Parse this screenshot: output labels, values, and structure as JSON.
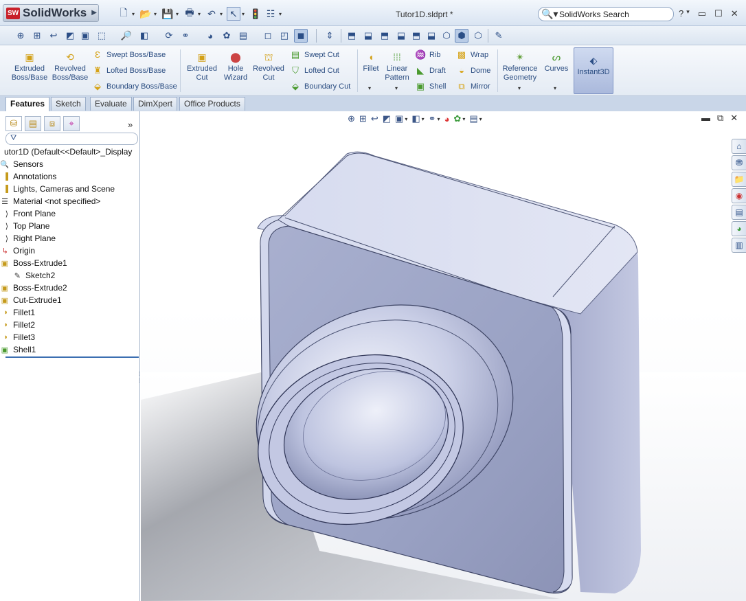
{
  "app": {
    "brand": "SolidWorks",
    "brand_badge": "SW",
    "document_title": "Tutor1D.sldprt *"
  },
  "quick_access": {
    "icons": [
      "new-document-icon",
      "open-folder-icon",
      "save-icon",
      "print-icon",
      "undo-icon",
      "select-pointer-icon",
      "rebuild-icon",
      "options-icon"
    ]
  },
  "search": {
    "value": "SolidWorks Search"
  },
  "window_controls": {
    "help": "?",
    "minimize": "▭",
    "maximize": "☐",
    "close": "✕"
  },
  "ribbon": {
    "extruded_boss": "Extruded Boss/Base",
    "revolved_boss": "Revolved Boss/Base",
    "swept_boss": "Swept Boss/Base",
    "lofted_boss": "Lofted Boss/Base",
    "boundary_boss": "Boundary Boss/Base",
    "extruded_cut": "Extruded Cut",
    "hole_wizard": "Hole Wizard",
    "revolved_cut": "Revolved Cut",
    "swept_cut": "Swept Cut",
    "lofted_cut": "Lofted Cut",
    "boundary_cut": "Boundary Cut",
    "fillet": "Fillet",
    "linear_pattern": "Linear Pattern",
    "rib": "Rib",
    "draft": "Draft",
    "shell": "Shell",
    "wrap": "Wrap",
    "dome": "Dome",
    "mirror": "Mirror",
    "reference_geometry": "Reference Geometry",
    "curves": "Curves",
    "instant3d": "Instant3D"
  },
  "tabs": [
    {
      "label": "Features",
      "active": true
    },
    {
      "label": "Sketch",
      "active": false
    },
    {
      "label": "Evaluate",
      "active": false
    },
    {
      "label": "DimXpert",
      "active": false
    },
    {
      "label": "Office Products",
      "active": false
    }
  ],
  "feature_tree": {
    "root": "utor1D  (Default<<Default>_Display",
    "items": [
      {
        "label": "Sensors",
        "icon": "sensor-icon"
      },
      {
        "label": "Annotations",
        "icon": "annotations-icon"
      },
      {
        "label": "Lights, Cameras and Scene",
        "icon": "lights-icon"
      },
      {
        "label": "Material <not specified>",
        "icon": "material-icon"
      },
      {
        "label": "Front Plane",
        "icon": "plane-icon"
      },
      {
        "label": "Top Plane",
        "icon": "plane-icon"
      },
      {
        "label": "Right Plane",
        "icon": "plane-icon"
      },
      {
        "label": "Origin",
        "icon": "origin-icon"
      },
      {
        "label": "Boss-Extrude1",
        "icon": "boss-extrude-icon"
      },
      {
        "label": "Sketch2",
        "icon": "sketch-icon",
        "indent": true
      },
      {
        "label": "Boss-Extrude2",
        "icon": "boss-extrude-icon"
      },
      {
        "label": "Cut-Extrude1",
        "icon": "cut-extrude-icon"
      },
      {
        "label": "Fillet1",
        "icon": "fillet-icon"
      },
      {
        "label": "Fillet2",
        "icon": "fillet-icon"
      },
      {
        "label": "Fillet3",
        "icon": "fillet-icon"
      },
      {
        "label": "Shell1",
        "icon": "shell-icon"
      }
    ]
  },
  "colors": {
    "part_face": "#9ea6c8",
    "part_highlight": "#dfe3f4",
    "accent": "#3c6fb1",
    "brand_red": "#c8202a"
  }
}
